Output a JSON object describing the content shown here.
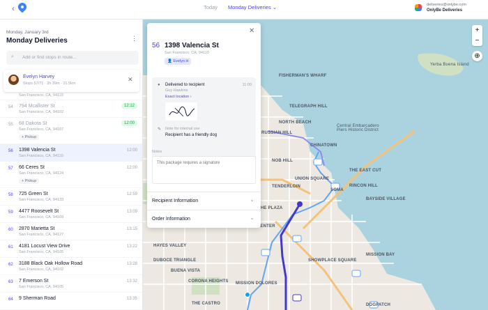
{
  "topbar": {
    "today_label": "Today",
    "route_label": "Monday Deliveries ⌄",
    "account_email": "deliveries@onlybe.com",
    "account_name": "OnlyBe Deliveries"
  },
  "sidebar": {
    "date": "Monday, January 3rd",
    "title": "Monday Deliveries",
    "search_placeholder": "Add or find stops in route...",
    "driver": {
      "name": "Evelyn Harvey",
      "meta": "Stops 57/71 · 2h 39m · 31.5km"
    },
    "stops": [
      {
        "num": "",
        "addr": "",
        "city": "San Francisco, CA, 94110",
        "time": "",
        "cut": true
      },
      {
        "num": "54",
        "addr": "794 Mcallister St",
        "city": "San Francisco, CA, 94102",
        "time": "12:12",
        "done": true
      },
      {
        "num": "55",
        "addr": "68 Dakota St",
        "city": "San Francisco, CA, 94107",
        "time": "12:00",
        "done": true,
        "pickup": "+ Pickup"
      },
      {
        "num": "56",
        "addr": "1398 Valencia St",
        "city": "San Francisco, CA, 94110",
        "time": "12:00",
        "active": true
      },
      {
        "num": "57",
        "addr": "66 Ceres St",
        "city": "San Francisco, CA, 94124",
        "time": "12:00",
        "pickup": "+ Pickup"
      },
      {
        "num": "58",
        "addr": "725 Green St",
        "city": "San Francisco, CA, 94133",
        "time": "12:59"
      },
      {
        "num": "59",
        "addr": "4477 Roosevelt St",
        "city": "San Francisco, CA, 94109",
        "time": "13:09"
      },
      {
        "num": "60",
        "addr": "2870 Marietta St",
        "city": "San Francisco, CA, 94127",
        "time": "13:15"
      },
      {
        "num": "61",
        "addr": "4181 Locust View Drive",
        "city": "San Francisco, CA, 94105",
        "time": "13:22"
      },
      {
        "num": "62",
        "addr": "3188 Black Oak Hollow Road",
        "city": "San Francisco, CA, 94102",
        "time": "13:28"
      },
      {
        "num": "63",
        "addr": "7 Emerson St",
        "city": "San Francisco, CA, 94105",
        "time": "13:32"
      },
      {
        "num": "64",
        "addr": "9 Sherman Road",
        "city": "",
        "time": "13:35"
      }
    ]
  },
  "detail": {
    "num": "56",
    "addr": "1398 Valencia St",
    "city": "San Francisco, CA, 94110",
    "driver_chip": "👤 Evelyn H",
    "status": "Delivered to recipient",
    "status_time": "11:00",
    "received_by": "Guy Hawkins",
    "exact_location": "Exact location ›",
    "note_label": "Note for internal use",
    "note": "Recipient has a friendly dog",
    "notes_label": "Notes",
    "notes_placeholder": "This package requires a signature",
    "sections": [
      "Recipient Information",
      "Order Information"
    ]
  },
  "map": {
    "labels": [
      "FISHERMAN'S WHARF",
      "NORTH BEACH",
      "TELEGRAPH HILL",
      "RUSSIAN HILL",
      "CHINATOWN",
      "Central Embarcadero Piers Historic District",
      "NOB HILL",
      "THE EAST CUT",
      "TENDERLOIN",
      "UNION SQUARE",
      "SOMA",
      "RINCON HILL",
      "BAYSIDE VILLAGE",
      "CIVIC CENTER",
      "SHOWPLACE SQUARE",
      "MISSION BAY",
      "CORONA HEIGHTS",
      "MISSION DOLORES",
      "THE CASTRO",
      "Yerba Buena Island",
      "DOGPATCH",
      "HAYES VALLEY",
      "DUBOCE TRIANGLE",
      "THE PLAZA",
      "BUENA VISTA"
    ]
  },
  "colors": {
    "accent": "#4f46e5",
    "route_main": "#4338ca",
    "route_alt": "#60a5fa",
    "water": "#aad3df"
  }
}
